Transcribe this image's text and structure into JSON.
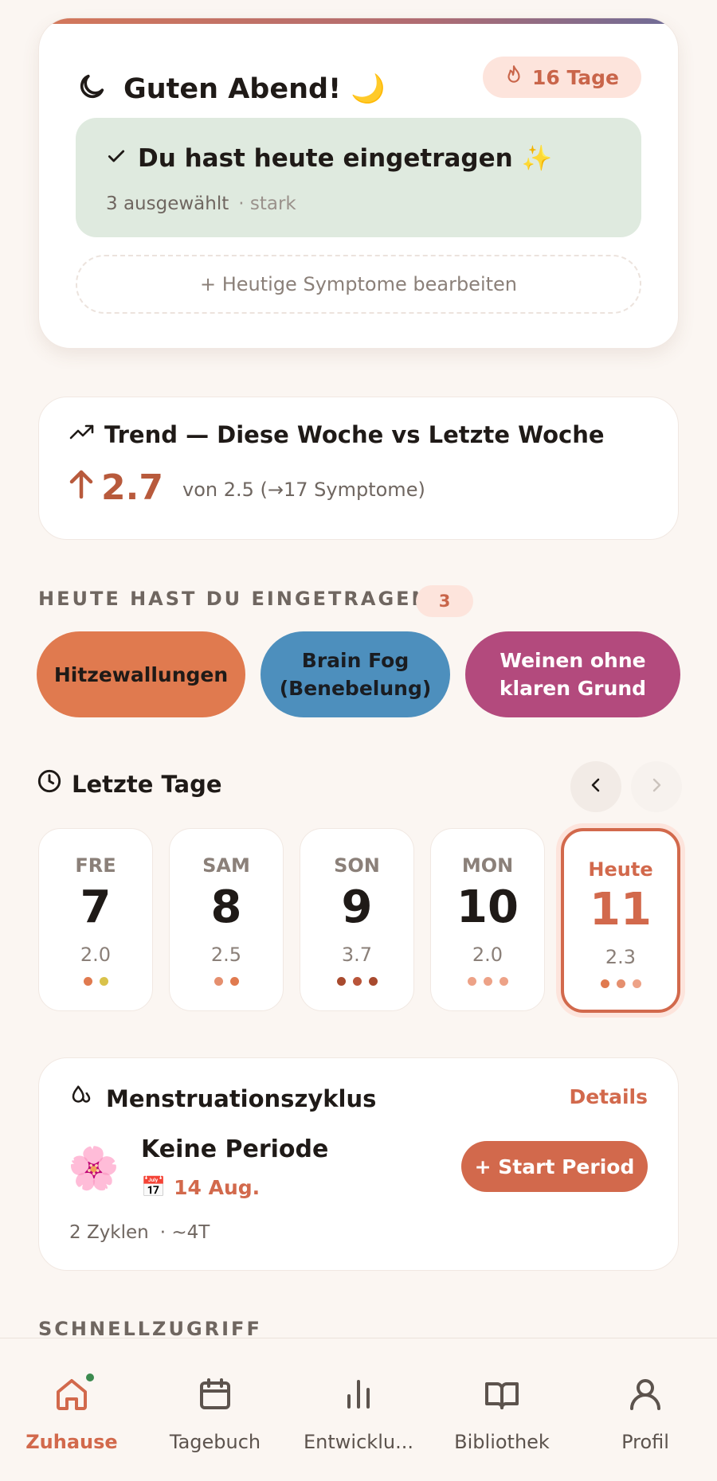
{
  "greeting": {
    "title": "Guten Abend! 🌙",
    "streak": "16 Tage",
    "logged_title": "Du hast heute eingetragen ✨",
    "logged_count": "3 ausgewählt",
    "logged_severity": "· stark",
    "edit_label": "+ Heutige Symptome bearbeiten"
  },
  "trend": {
    "title": "Trend — Diese Woche vs Letzte Woche",
    "value": "2.7",
    "subtitle": "von 2.5 (→17 Symptome)"
  },
  "today": {
    "label": "HEUTE HAST DU EINGETRAGEN",
    "count": "3",
    "symptoms": [
      "Hitzewallungen",
      "Brain Fog (Benebelung)",
      "Weinen ohne klaren Grund"
    ]
  },
  "recent": {
    "title": "Letzte Tage",
    "days": [
      {
        "weekday": "FRE",
        "day": "7",
        "score": "2.0",
        "dots": [
          "#e07a4f",
          "#d9c24a"
        ]
      },
      {
        "weekday": "SAM",
        "day": "8",
        "score": "2.5",
        "dots": [
          "#e58f6e",
          "#e07a4f"
        ]
      },
      {
        "weekday": "SON",
        "day": "9",
        "score": "3.7",
        "dots": [
          "#a84a2e",
          "#b9553a",
          "#a84a2e"
        ]
      },
      {
        "weekday": "MON",
        "day": "10",
        "score": "2.0",
        "dots": [
          "#eda287",
          "#eda287",
          "#eda287"
        ]
      },
      {
        "weekday": "Heute",
        "day": "11",
        "score": "2.3",
        "dots": [
          "#e07a4f",
          "#e58f6e",
          "#eda287"
        ]
      }
    ]
  },
  "cycle": {
    "title": "Menstruationszyklus",
    "details": "Details",
    "status": "Keine Periode",
    "date": "14 Aug.",
    "start_button": "+ Start Period",
    "cycles": "2 Zyklen",
    "length": "· ~4T"
  },
  "quick": {
    "label": "SCHNELLZUGRIFF"
  },
  "nav": {
    "items": [
      "Zuhause",
      "Tagebuch",
      "Entwicklu...",
      "Bibliothek",
      "Profil"
    ]
  },
  "colors": {
    "accent": "#d2694c",
    "success_bg": "#dfeadf",
    "badge_bg": "#fde4dc"
  }
}
